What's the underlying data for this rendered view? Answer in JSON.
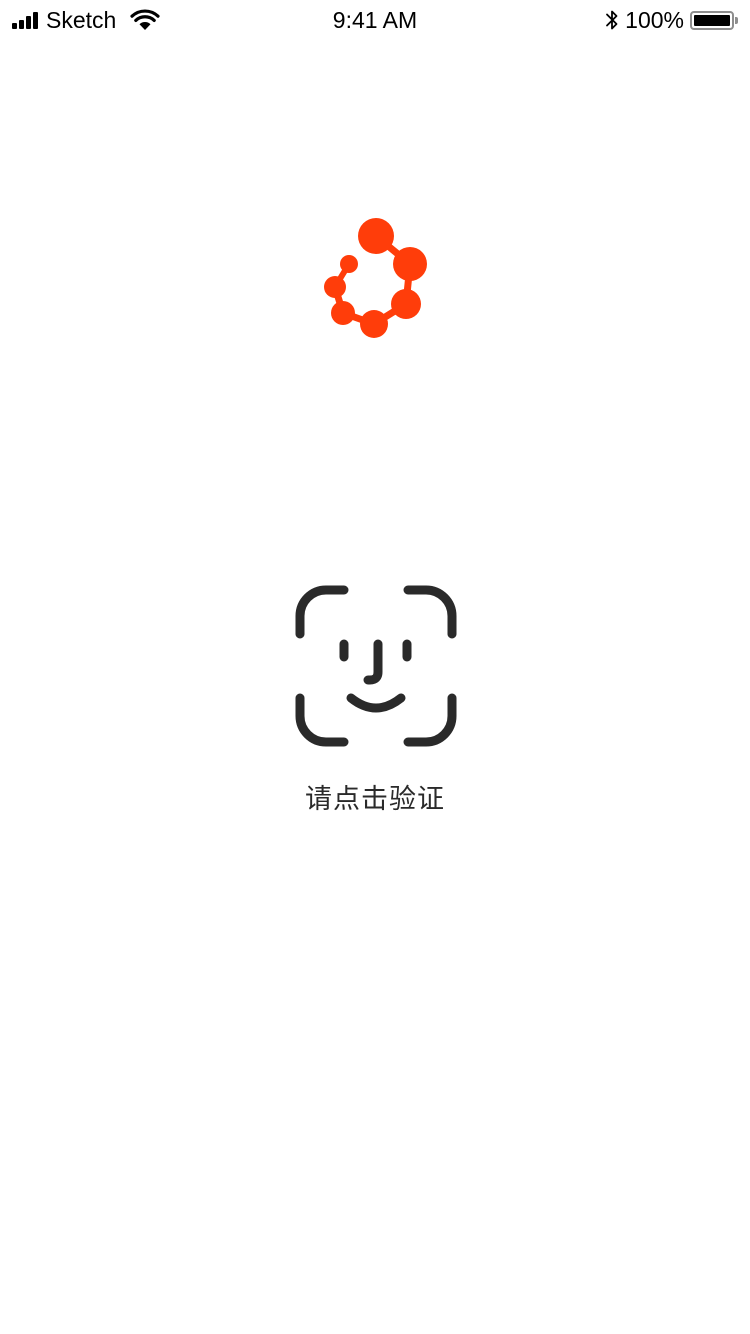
{
  "status_bar": {
    "carrier": "Sketch",
    "time": "9:41 AM",
    "battery_percent": "100%",
    "signal_icon": "signal-bars-icon",
    "wifi_icon": "wifi-icon",
    "bluetooth_icon": "bluetooth-icon",
    "battery_icon": "battery-icon"
  },
  "logo": {
    "icon": "brand-logo-icon",
    "color": "#FF3D0A"
  },
  "verification": {
    "icon": "face-id-icon",
    "icon_color": "#2A2A2A",
    "prompt": "请点击验证"
  }
}
